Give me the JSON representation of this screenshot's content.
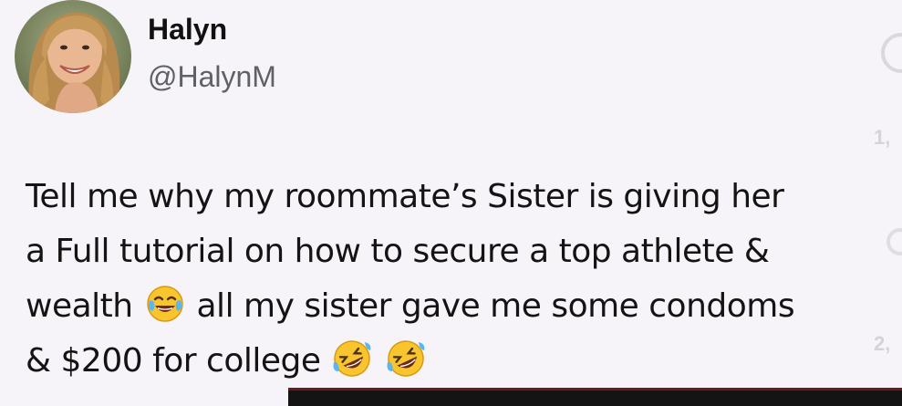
{
  "author": {
    "display_name": "Halyn",
    "handle": "@HalynM",
    "avatar_icon": "profile-photo"
  },
  "tweet": {
    "lines": [
      {
        "text": "Tell me why my roommate’s Sister is giving her"
      },
      {
        "text": "a Full tutorial on how to secure a top athlete &"
      },
      {
        "before": "wealth",
        "emoji": "face-with-tears-of-joy-icon",
        "after": "all my sister gave me some condoms"
      },
      {
        "before": "& $200 for college",
        "emojis": [
          "rolling-on-the-floor-laughing-icon",
          "rolling-on-the-floor-laughing-icon"
        ]
      }
    ]
  },
  "side_panel": {
    "count_1": "1,",
    "count_2": "2,"
  },
  "colors": {
    "background": "#f6f4f8",
    "text": "#141414",
    "handle": "#5e6166",
    "emoji_yellow": "#f9c52f"
  }
}
